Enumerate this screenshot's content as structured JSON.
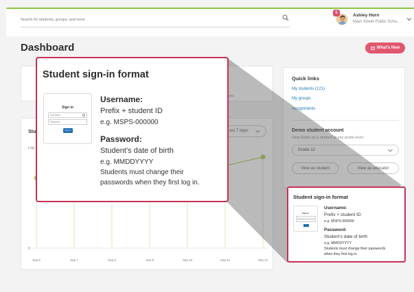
{
  "header": {
    "search_placeholder": "Search for students, groups, and more",
    "notification_count": "5",
    "user_name": "Ashley Horn",
    "school_name": "Main Street Public Scho..."
  },
  "dashboard": {
    "title": "Dashboard",
    "whats_new_label": "What's New"
  },
  "top_card": {
    "partial_text": "ts like a pro."
  },
  "quick_links": {
    "title": "Quick links",
    "links": [
      "My students (121)",
      "My groups",
      "Assignments"
    ]
  },
  "demo": {
    "title": "Demo student account",
    "subtitle": "View Kiddo as a student at any grade level.",
    "grade_value": "Grade 12",
    "view_student_label": "View as student",
    "view_educator_label": "View as educator"
  },
  "chart_card": {
    "title_partial": "Stu",
    "subtitle_partial": "Log",
    "range_label": "ast 7 days"
  },
  "chart_data": {
    "type": "line",
    "categories": [
      "Sep 6",
      "Sep 7",
      "Sep 8",
      "Sep 9",
      "Sep 10",
      "Sep 11",
      "Sep 12"
    ],
    "y_tick_labels": [
      "0"
    ],
    "visible_points": [
      {
        "category_index": 0,
        "relative_level": 0.77
      },
      {
        "category_index": 6,
        "relative_level": 1.0
      }
    ],
    "color": "#a9cf63",
    "bar_color": "#d8e8b6"
  },
  "popup": {
    "title": "Student sign-in format",
    "username_label": "Username:",
    "username_line1": "Prefix + student ID",
    "username_line2": "e.g. MSPS-000000",
    "password_label": "Password:",
    "password_line1": "Student’s date of birth",
    "password_line2": "e.g. MMDDYYYY",
    "password_line3": "Students must change their",
    "password_line4": "passwords when they first log in."
  },
  "thumb": {
    "title": "Sign in",
    "username_placeholder": "Username",
    "password_placeholder": "Password",
    "button_label": "Sign in"
  },
  "mini": {
    "title": "Student sign-in format",
    "username_label": "Username:",
    "username_line1": "Prefix + student ID",
    "username_line2": "e.g. MSPS-000000",
    "password_label": "Password:",
    "password_line1": "Student’s date of birth",
    "password_line2": "e.g. MMDDYYYY",
    "password_line3": "Students must change their passwords",
    "password_line4": "when they first log in."
  },
  "colors": {
    "accent_red": "#c53053",
    "whats_new_pink": "#e2566f",
    "link_blue": "#1f78b4",
    "top_stripe": "#8dc63f"
  }
}
